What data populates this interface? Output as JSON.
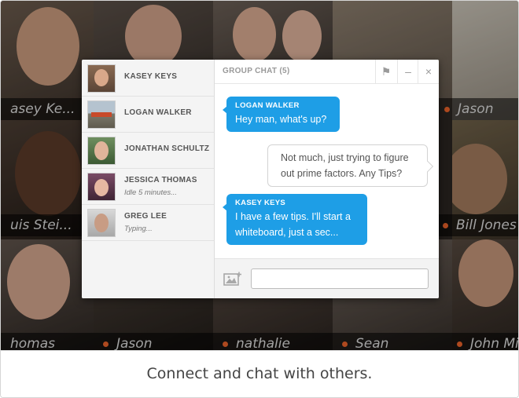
{
  "video_grid": {
    "participants": [
      {
        "name": "asey Ke..."
      },
      {
        "name": "Jason"
      },
      {
        "name": "uis Stei..."
      },
      {
        "name": "Bill Jones"
      },
      {
        "name": "homas"
      },
      {
        "name": "Jason"
      },
      {
        "name": "nathalie"
      },
      {
        "name": "Sean"
      },
      {
        "name": "John Mi"
      }
    ],
    "status_color": "#e8622a"
  },
  "chat": {
    "title": "GROUP CHAT (5)",
    "header_icons": [
      "flag-icon",
      "minimize-icon",
      "close-icon"
    ],
    "header_glyphs": {
      "flag": "⚑",
      "minimize": "–",
      "close": "×"
    },
    "roster": [
      {
        "name": "KASEY KEYS",
        "status": ""
      },
      {
        "name": "LOGAN WALKER",
        "status": ""
      },
      {
        "name": "JONATHAN SCHULTZ",
        "status": ""
      },
      {
        "name": "JESSICA THOMAS",
        "status": "Idle 5 minutes..."
      },
      {
        "name": "GREG LEE",
        "status": "Typing..."
      }
    ],
    "messages": [
      {
        "sender": "LOGAN WALKER",
        "text": "Hey man, what's up?",
        "direction": "in"
      },
      {
        "sender": "",
        "text": "Not much, just trying to figure out prime factors. Any Tips?",
        "direction": "out"
      },
      {
        "sender": "KASEY KEYS",
        "text": "I have a few tips. I'll start a whiteboard, just a sec...",
        "direction": "in"
      }
    ],
    "composer": {
      "value": "",
      "placeholder": "",
      "attach_icon": "image-add-icon"
    },
    "accent_color": "#1e9ee6"
  },
  "caption": "Connect and chat with others."
}
